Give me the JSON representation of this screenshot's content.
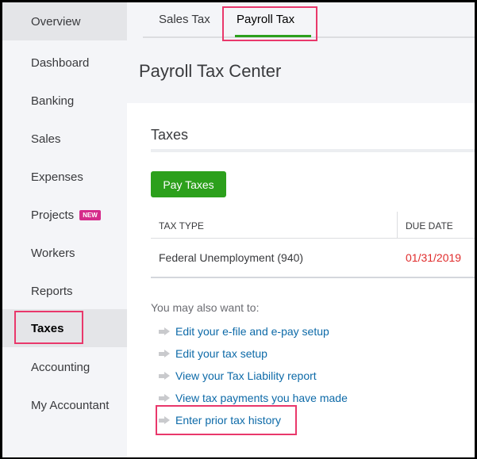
{
  "sidebar": {
    "items": [
      {
        "label": "Overview"
      },
      {
        "label": "Dashboard"
      },
      {
        "label": "Banking"
      },
      {
        "label": "Sales"
      },
      {
        "label": "Expenses"
      },
      {
        "label": "Projects",
        "badge": "NEW"
      },
      {
        "label": "Workers"
      },
      {
        "label": "Reports"
      },
      {
        "label": "Taxes"
      },
      {
        "label": "Accounting"
      },
      {
        "label": "My Accountant"
      }
    ]
  },
  "tabs": [
    {
      "label": "Sales Tax"
    },
    {
      "label": "Payroll Tax"
    }
  ],
  "page_title": "Payroll Tax Center",
  "section": {
    "title": "Taxes",
    "pay_button": "Pay Taxes",
    "table": {
      "headers": [
        "TAX TYPE",
        "DUE DATE"
      ],
      "rows": [
        {
          "tax_type": "Federal Unemployment (940)",
          "due_date": "01/31/2019"
        }
      ]
    }
  },
  "also": {
    "label": "You may also want to:",
    "links": [
      "Edit your e-file and e-pay setup",
      "Edit your tax setup",
      "View your Tax Liability report",
      "View tax payments you have made",
      "Enter prior tax history"
    ]
  },
  "colors": {
    "accent": "#2ca01c",
    "highlight": "#e9386b",
    "due": "#e02c2c",
    "link": "#0d6aa8"
  }
}
